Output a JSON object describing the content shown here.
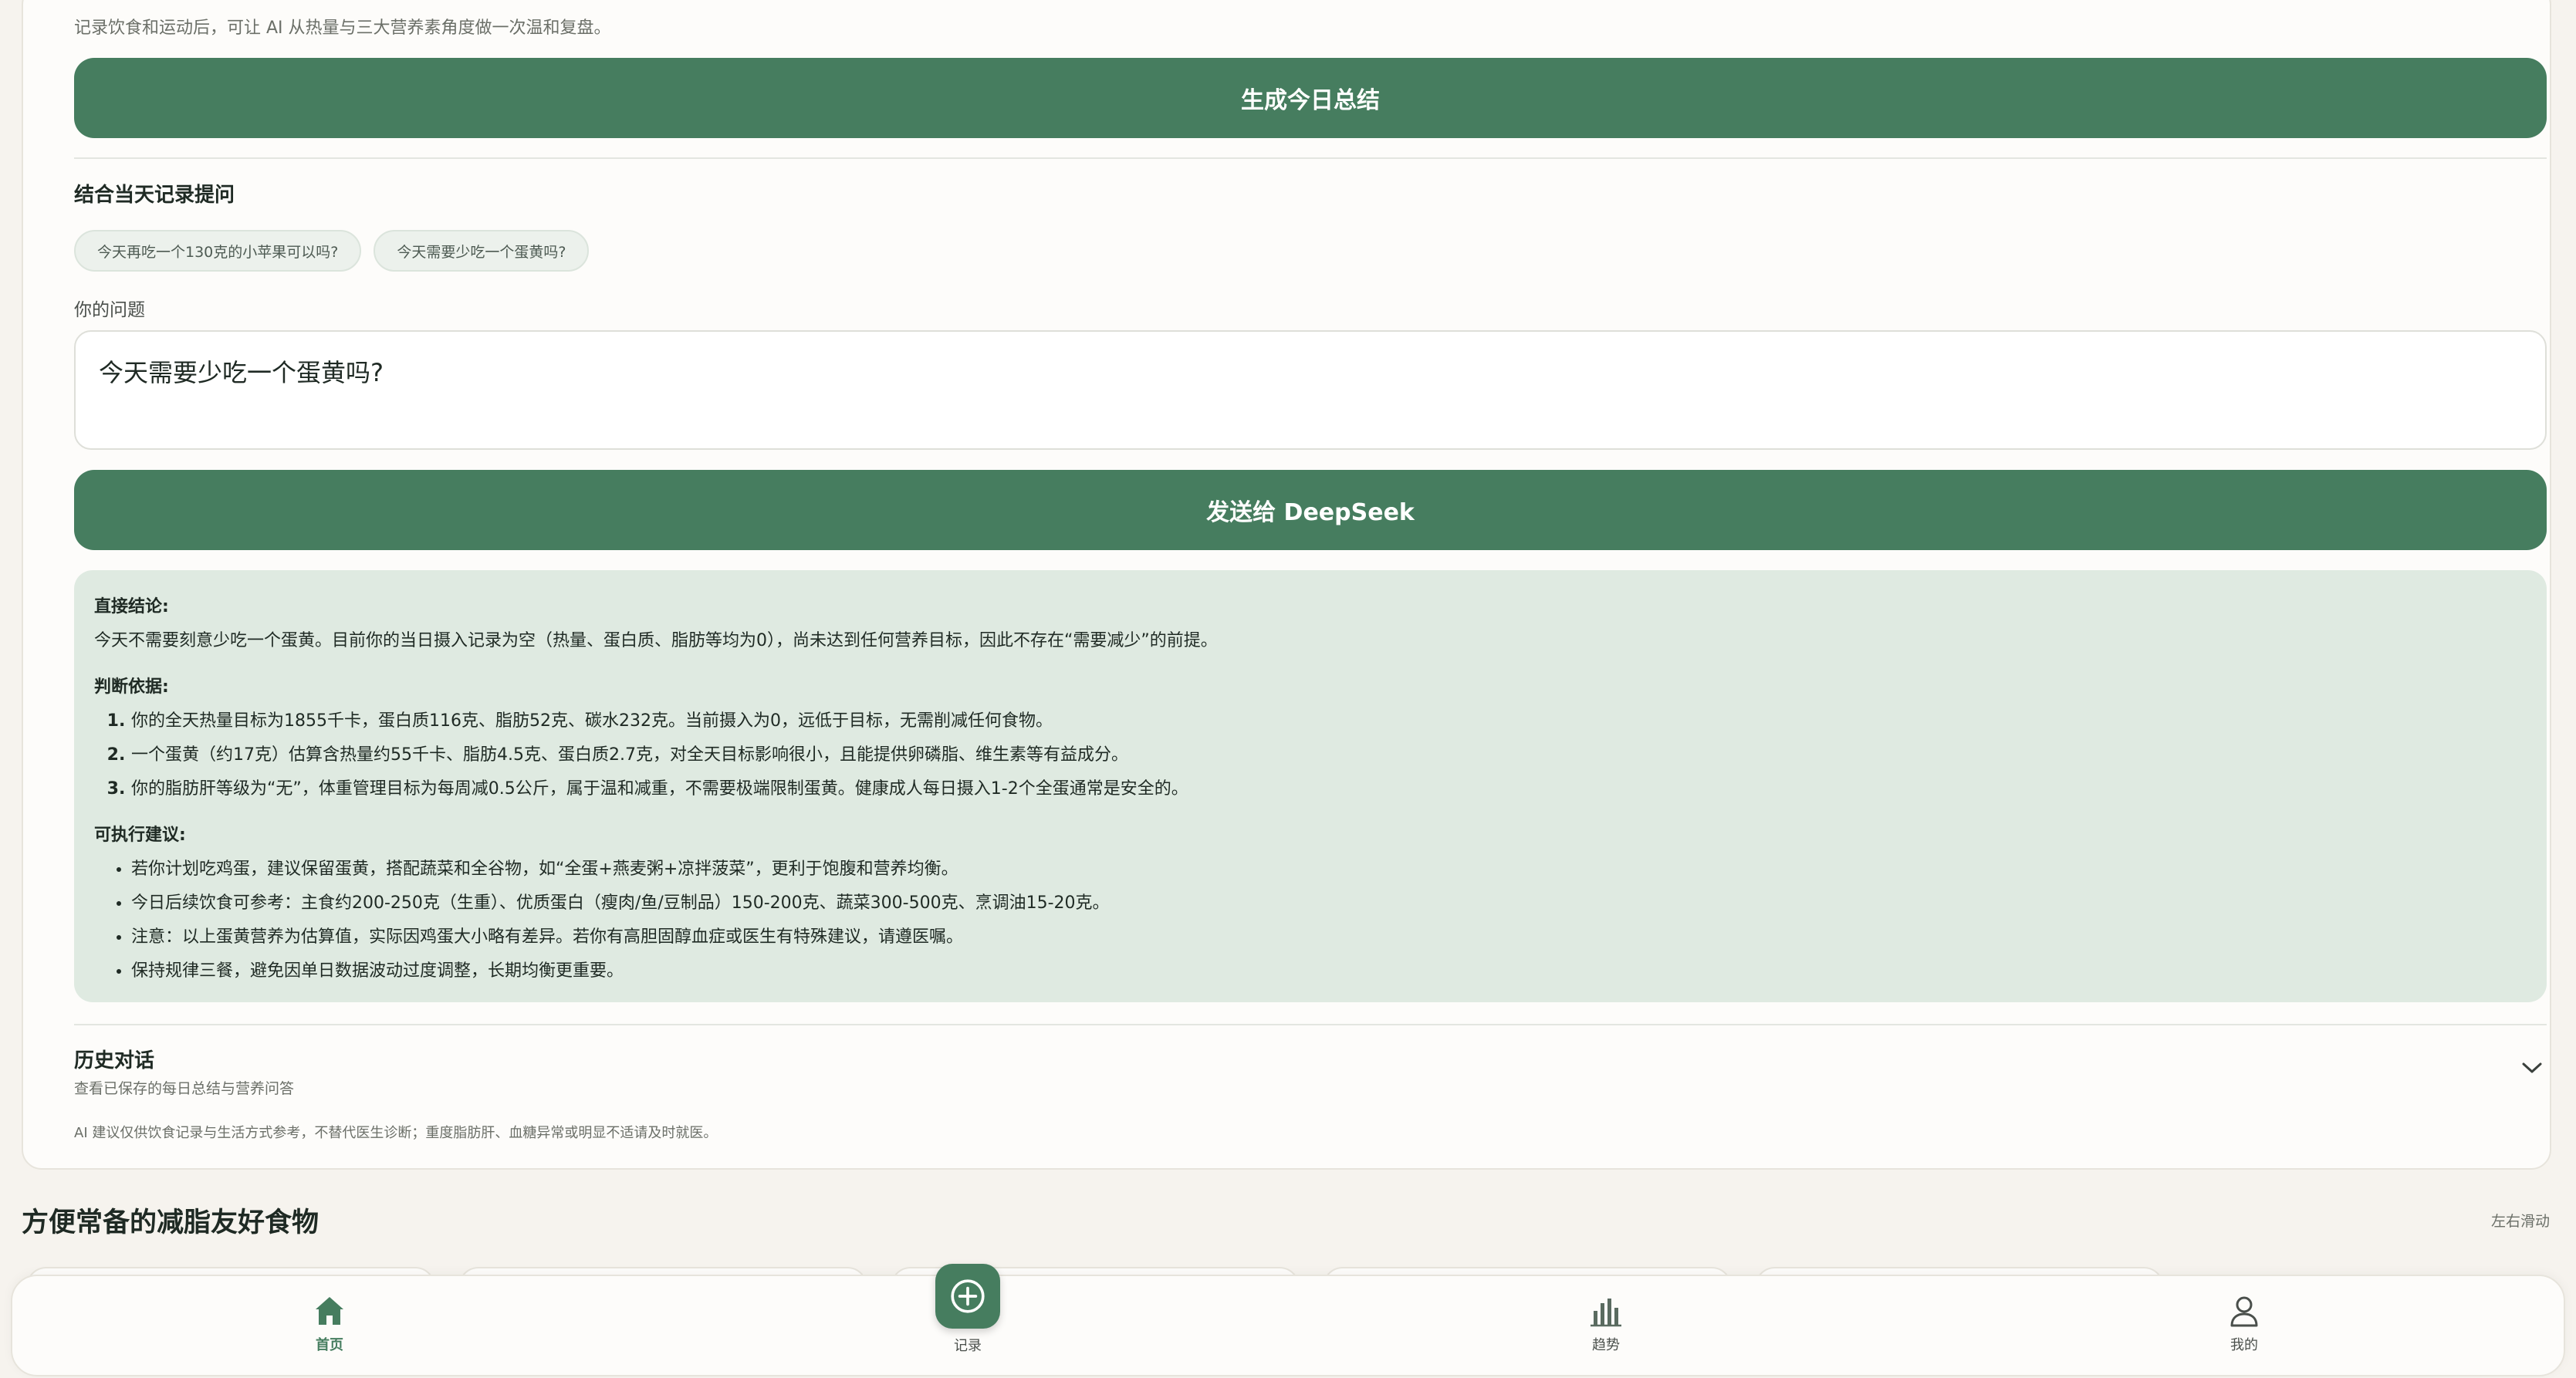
{
  "summary": {
    "hint": "记录饮食和运动后，可让 AI 从热量与三大营养素角度做一次温和复盘。",
    "generate_label": "生成今日总结"
  },
  "ask": {
    "section_title": "结合当天记录提问",
    "chips": [
      "今天再吃一个130克的小苹果可以吗?",
      "今天需要少吃一个蛋黄吗?"
    ],
    "question_label": "你的问题",
    "question_value": "今天需要少吃一个蛋黄吗?",
    "send_label": "发送给 DeepSeek"
  },
  "answer": {
    "conclusion_heading": "直接结论:",
    "conclusion_text": "今天不需要刻意少吃一个蛋黄。目前你的当日摄入记录为空（热量、蛋白质、脂肪等均为0），尚未达到任何营养目标，因此不存在“需要减少”的前提。",
    "basis_heading": "判断依据:",
    "basis_items": [
      "你的全天热量目标为1855千卡，蛋白质116克、脂肪52克、碳水232克。当前摄入为0，远低于目标，无需削减任何食物。",
      "一个蛋黄（约17克）估算含热量约55千卡、脂肪4.5克、蛋白质2.7克，对全天目标影响很小，且能提供卵磷脂、维生素等有益成分。",
      "你的脂肪肝等级为“无”，体重管理目标为每周减0.5公斤，属于温和减重，不需要极端限制蛋黄。健康成人每日摄入1-2个全蛋通常是安全的。"
    ],
    "advice_heading": "可执行建议:",
    "advice_items": [
      "若你计划吃鸡蛋，建议保留蛋黄，搭配蔬菜和全谷物，如“全蛋+燕麦粥+凉拌菠菜”，更利于饱腹和营养均衡。",
      "今日后续饮食可参考：主食约200-250克（生重）、优质蛋白（瘦肉/鱼/豆制品）150-200克、蔬菜300-500克、烹调油15-20克。",
      "注意：以上蛋黄营养为估算值，实际因鸡蛋大小略有差异。若你有高胆固醇血症或医生有特殊建议，请遵医嘱。",
      "保持规律三餐，避免因单日数据波动过度调整，长期均衡更重要。"
    ]
  },
  "history": {
    "title": "历史对话",
    "subtitle": "查看已保存的每日总结与营养问答"
  },
  "disclaimer": "AI 建议仅供饮食记录与生活方式参考，不替代医生诊断；重度脂肪肝、血糖异常或明显不适请及时就医。",
  "foods": {
    "title": "方便常备的减脂友好食物",
    "swipe_hint": "左右滑动"
  },
  "tabbar": {
    "home": "首页",
    "record": "记录",
    "trends": "趋势",
    "me": "我的"
  },
  "colors": {
    "accent": "#467d5f",
    "answer_bg": "#dfeae1",
    "page_bg": "#f6f3ee"
  }
}
